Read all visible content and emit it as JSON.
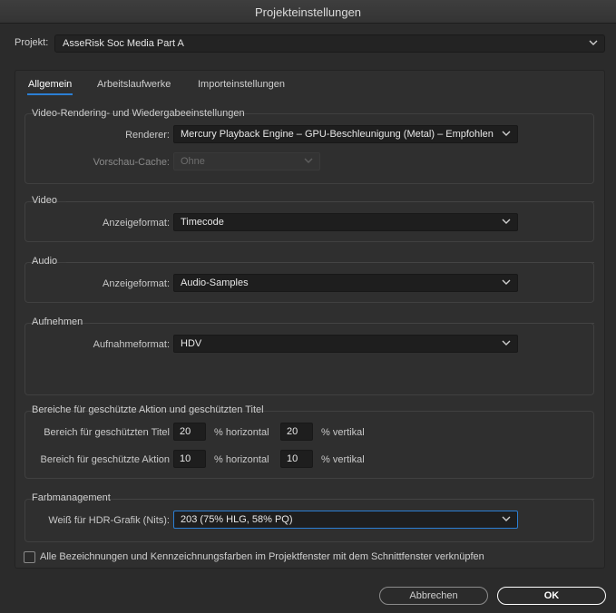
{
  "window": {
    "title": "Projekteinstellungen"
  },
  "project": {
    "label": "Projekt:",
    "value": "AsseRisk Soc Media Part A"
  },
  "tabs": [
    {
      "label": "Allgemein",
      "active": true
    },
    {
      "label": "Arbeitslaufwerke",
      "active": false
    },
    {
      "label": "Importeinstellungen",
      "active": false
    }
  ],
  "rendering": {
    "title": "Video-Rendering- und Wiedergabeeinstellungen",
    "renderer_label": "Renderer:",
    "renderer_value": "Mercury Playback Engine – GPU-Beschleunigung (Metal) – Empfohlen",
    "cache_label": "Vorschau-Cache:",
    "cache_value": "Ohne"
  },
  "video": {
    "title": "Video",
    "format_label": "Anzeigeformat:",
    "format_value": "Timecode"
  },
  "audio": {
    "title": "Audio",
    "format_label": "Anzeigeformat:",
    "format_value": "Audio-Samples"
  },
  "capture": {
    "title": "Aufnehmen",
    "format_label": "Aufnahmeformat:",
    "format_value": "HDV"
  },
  "safe_areas": {
    "title": "Bereiche für geschützte Aktion und geschützten Titel",
    "title_safe_label": "Bereich für geschützten Titel",
    "title_h": "20",
    "title_v": "20",
    "action_safe_label": "Bereich für geschützte Aktion",
    "action_h": "10",
    "action_v": "10",
    "h_unit": "% horizontal",
    "v_unit": "% vertikal"
  },
  "color": {
    "title": "Farbmanagement",
    "hdr_label": "Weiß für HDR-Grafik (Nits):",
    "hdr_value": "203 (75% HLG, 58% PQ)"
  },
  "link_checkbox": {
    "label": "Alle Bezeichnungen und Kennzeichnungsfarben im Projektfenster mit dem Schnittfenster verknüpfen",
    "checked": false
  },
  "buttons": {
    "cancel": "Abbrechen",
    "ok": "OK"
  },
  "colors": {
    "accent": "#2b7fd4",
    "background": "#2b2b2b",
    "panel": "#2f2f2f",
    "field": "#1e1e1e"
  }
}
